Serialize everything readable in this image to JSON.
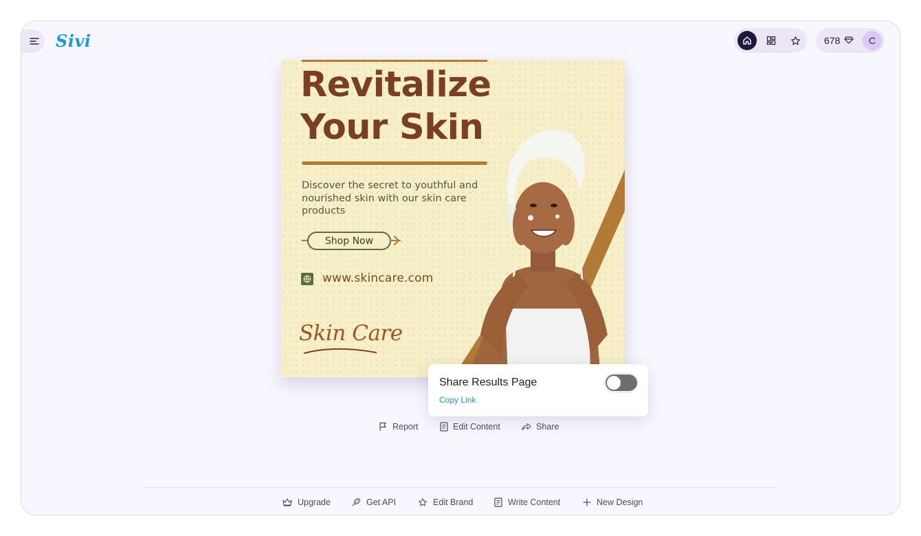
{
  "header": {
    "logo": "Sivi",
    "credits": "678",
    "avatar_initial": "C"
  },
  "poster": {
    "headline_line1": "Revitalize",
    "headline_line2": "Your Skin",
    "subtext": "Discover the secret to youthful and nourished skin with our skin care products",
    "cta": "Shop Now",
    "url": "www.skincare.com",
    "brand": "Skin Care"
  },
  "share_popover": {
    "title": "Share Results Page",
    "copy_link": "Copy Link",
    "toggle_on": false
  },
  "actions": {
    "report": "Report",
    "edit_content": "Edit Content",
    "share": "Share"
  },
  "bottom_nav": {
    "upgrade": "Upgrade",
    "get_api": "Get API",
    "edit_brand": "Edit Brand",
    "write_content": "Write Content",
    "new_design": "New Design"
  },
  "colors": {
    "accent": "#1c9ad6",
    "poster_bg": "#f7efc9",
    "headline": "#7a3f21",
    "gold": "#b17a37"
  }
}
